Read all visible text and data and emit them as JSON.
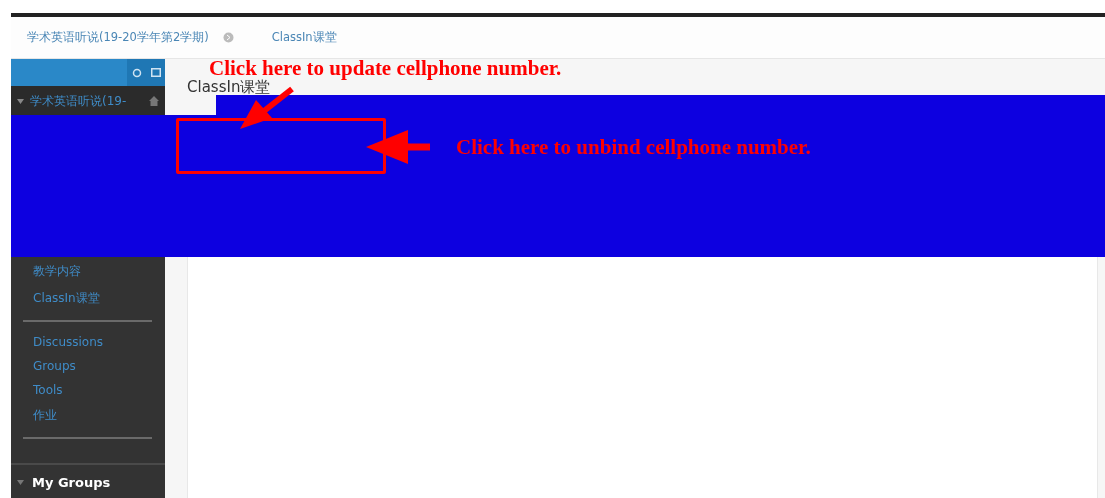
{
  "breadcrumb": [
    {
      "label": "学术英语听说(19-20学年第2学期)"
    },
    {
      "label": "ClassIn课堂"
    }
  ],
  "sidebar": {
    "course": "学术英语听说(19-",
    "sections": [
      {
        "items": [
          "教学内容",
          "ClassIn课堂"
        ]
      },
      {
        "items": [
          "Discussions",
          "Groups",
          "Tools",
          "作业"
        ]
      }
    ],
    "my_groups": "My Groups"
  },
  "page": {
    "title": "ClassIn课堂"
  },
  "annotations": [
    {
      "kind": "update",
      "text": "Click here to update cellphone number."
    },
    {
      "kind": "unbind",
      "text": "Click here to unbind cellphone number."
    }
  ]
}
